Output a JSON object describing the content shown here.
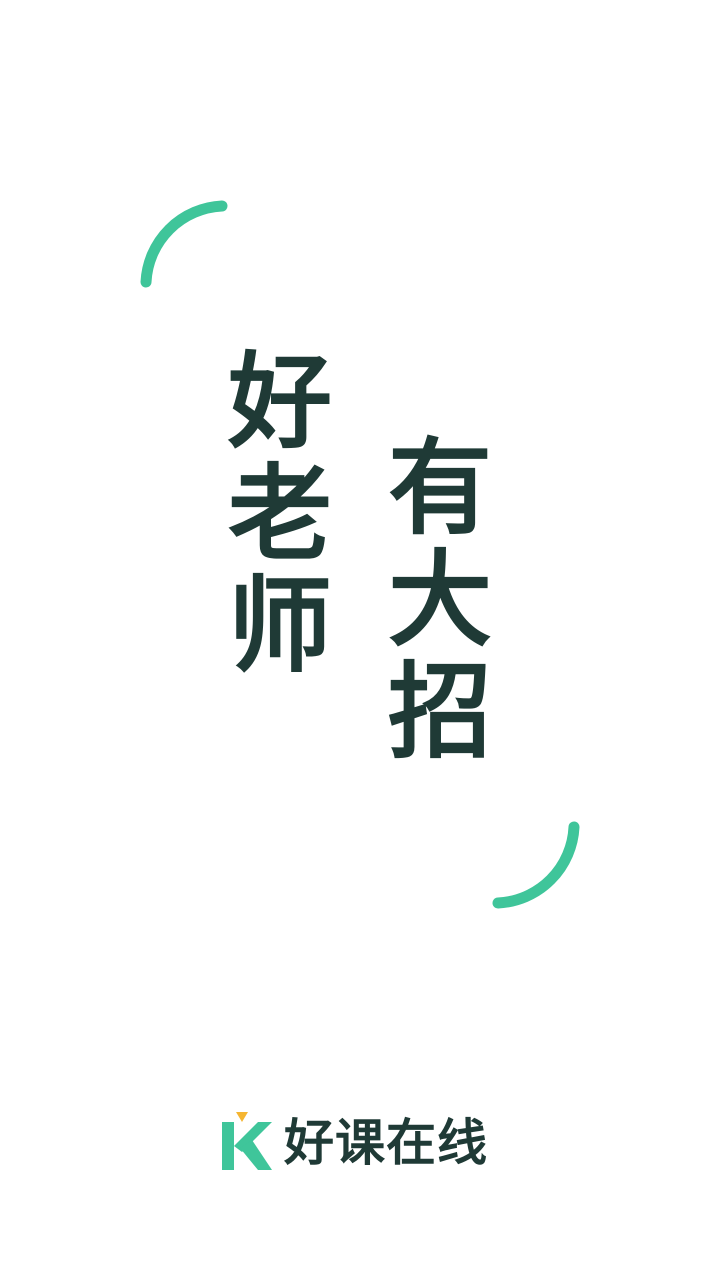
{
  "slogan": {
    "left_column": [
      "好",
      "老",
      "师"
    ],
    "right_column": [
      "有",
      "大",
      "招"
    ]
  },
  "brand": {
    "name": "好课在线",
    "logo_icon": "k-logo-icon"
  },
  "colors": {
    "accent": "#3fc59a",
    "text": "#1f3a36",
    "logo_accent": "#f5b531",
    "background": "#ffffff"
  }
}
